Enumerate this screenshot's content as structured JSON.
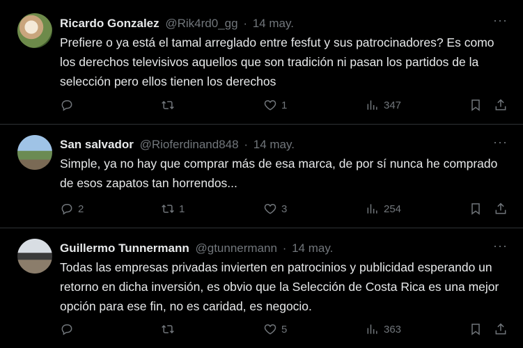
{
  "tweets": [
    {
      "name": "Ricardo Gonzalez",
      "handle": "@Rik4rd0_gg",
      "dot": "·",
      "date": "14 may.",
      "more": "···",
      "text": "Prefiere o ya está el tamal arreglado entre fesfut y sus patrocinadores? Es como los derechos televisivos aquellos que son tradición ni pasan los partidos de la selección pero ellos tienen los derechos",
      "replies": "",
      "retweets": "",
      "likes": "1",
      "views": "347"
    },
    {
      "name": "San salvador",
      "handle": "@Rioferdinand848",
      "dot": "·",
      "date": "14 may.",
      "more": "···",
      "text": "Simple, ya no hay que comprar más de esa marca, de por sí nunca he comprado de esos zapatos tan horrendos...",
      "replies": "2",
      "retweets": "1",
      "likes": "3",
      "views": "254"
    },
    {
      "name": "Guillermo Tunnermann",
      "handle": "@gtunnermann",
      "dot": "·",
      "date": "14 may.",
      "more": "···",
      "text": "Todas las empresas privadas invierten en patrocinios y publicidad esperando un retorno en dicha inversión, es obvio que la Selección de Costa Rica es una mejor opción para ese fin, no es caridad, es negocio.",
      "replies": "",
      "retweets": "",
      "likes": "5",
      "views": "363"
    }
  ],
  "icons": {
    "reply": "reply-icon",
    "retweet": "retweet-icon",
    "like": "heart-icon",
    "views": "views-icon",
    "bookmark": "bookmark-icon",
    "share": "share-icon"
  },
  "colors": {
    "background": "#000000",
    "text": "#e7e9ea",
    "muted": "#71767b",
    "divider": "#2f3336"
  }
}
